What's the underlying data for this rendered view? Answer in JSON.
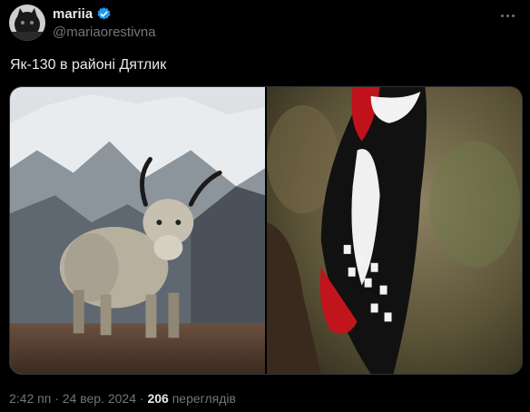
{
  "author": {
    "display_name": "mariia",
    "handle": "@mariaorestivna",
    "verified_color": "#1d9bf0"
  },
  "tweet": {
    "text": "Як-130 в районі Дятлик"
  },
  "media": [
    {
      "description_icon": "yak-photo"
    },
    {
      "description_icon": "woodpecker-photo"
    }
  ],
  "footer": {
    "time": "2:42 пп",
    "separator": "·",
    "date": "24 вер. 2024",
    "views_count": "206",
    "views_label": "переглядів"
  },
  "colors": {
    "background": "#000000",
    "text_primary": "#e7e9ea",
    "text_secondary": "#71767b",
    "accent": "#1d9bf0"
  }
}
